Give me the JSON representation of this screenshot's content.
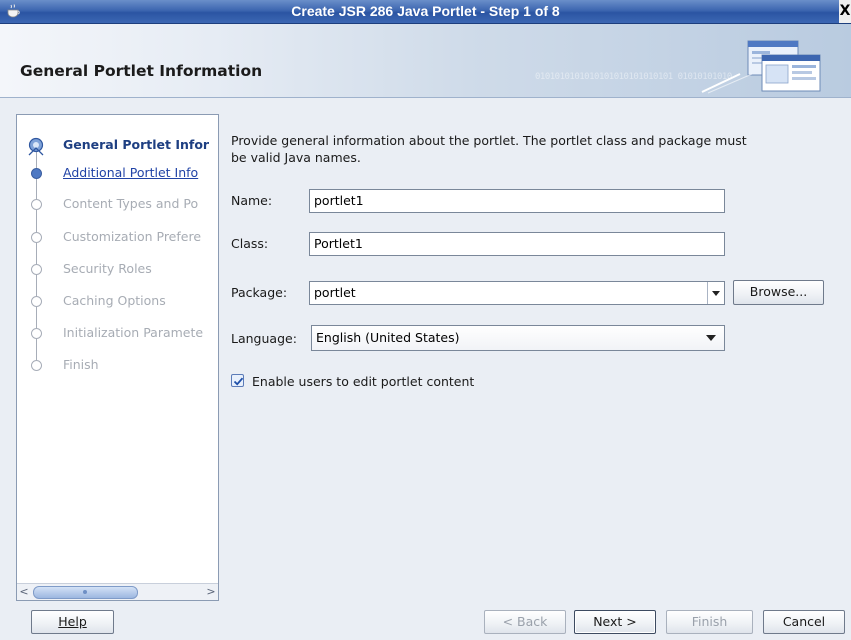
{
  "window": {
    "title": "Create JSR 286 Java Portlet - Step 1 of 8",
    "close_glyph": "X",
    "app_icon": "coffee-cup-icon"
  },
  "header": {
    "title": "General Portlet Information",
    "decoration_binary": "0101010101010101010101010101 01010101010"
  },
  "nav": {
    "items": [
      {
        "label": "General Portlet Infor",
        "state": "current"
      },
      {
        "label": "Additional Portlet Info",
        "state": "next"
      },
      {
        "label": "Content Types and Po",
        "state": "disabled"
      },
      {
        "label": "Customization Prefere",
        "state": "disabled"
      },
      {
        "label": "Security Roles",
        "state": "disabled"
      },
      {
        "label": "Caching Options",
        "state": "disabled"
      },
      {
        "label": "Initialization Paramete",
        "state": "disabled"
      },
      {
        "label": "Finish",
        "state": "disabled"
      }
    ],
    "scroll_left": "<",
    "scroll_right": ">"
  },
  "form": {
    "description": "Provide general information about the portlet. The portlet class and package must be valid Java names.",
    "name_label": "Name:",
    "name_value": "portlet1",
    "class_label": "Class:",
    "class_value": "Portlet1",
    "package_label": "Package:",
    "package_value": "portlet",
    "browse_label": "Browse...",
    "language_label": "Language:",
    "language_value": "English (United States)",
    "enable_edit_label": "Enable users to edit portlet content",
    "enable_edit_checked": true
  },
  "buttons": {
    "help": "Help",
    "back": "< Back",
    "next": "Next >",
    "finish": "Finish",
    "cancel": "Cancel"
  },
  "colors": {
    "titlebar": "#3d66b0",
    "current_step": "#1e3f82",
    "link": "#2143a6",
    "disabled_text": "#a7acb4"
  }
}
